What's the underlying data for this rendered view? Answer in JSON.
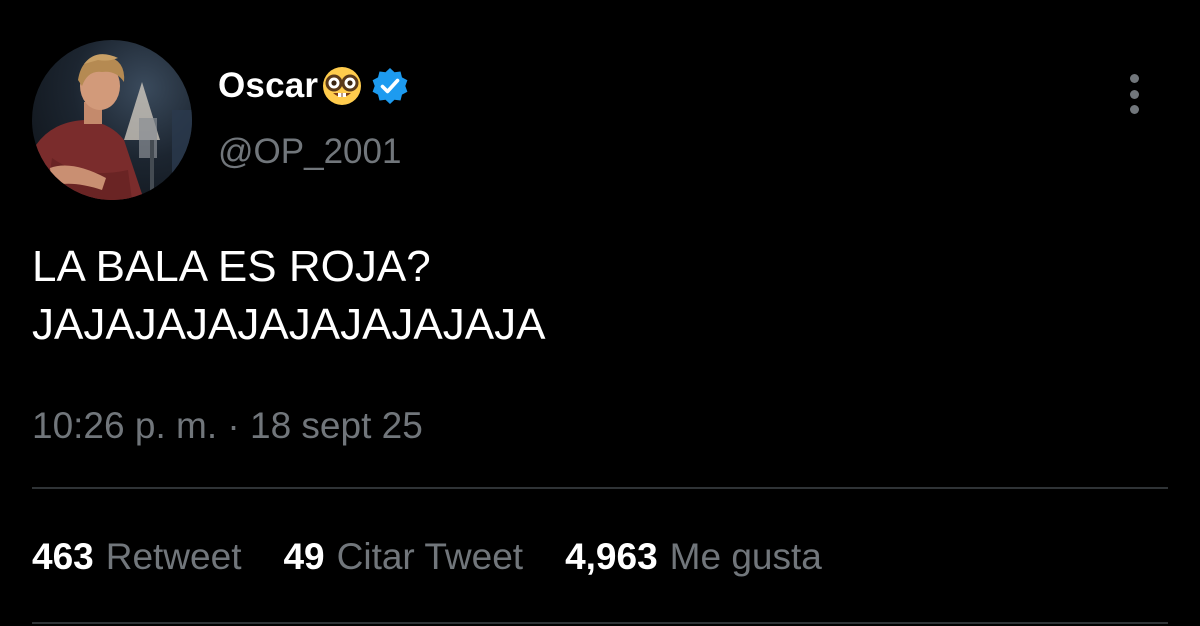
{
  "author": {
    "display_name": "Oscar",
    "handle": "@OP_2001",
    "emoji": "nerd-face-icon",
    "verified_icon": "verified-badge-icon"
  },
  "tweet": {
    "lines": [
      "LA BALA ES ROJA?",
      "JAJAJAJAJAJAJAJAJAJA"
    ],
    "timestamp": "10:26 p. m. · 18 sept 25"
  },
  "stats": [
    {
      "count": "463",
      "label": "Retweet"
    },
    {
      "count": "49",
      "label": "Citar Tweet"
    },
    {
      "count": "4,963",
      "label": "Me gusta"
    }
  ],
  "colors": {
    "background": "#000000",
    "primary_text": "#ffffff",
    "secondary_text": "#71767b",
    "verified_blue": "#1d9bf0",
    "divider": "#2f3336"
  }
}
